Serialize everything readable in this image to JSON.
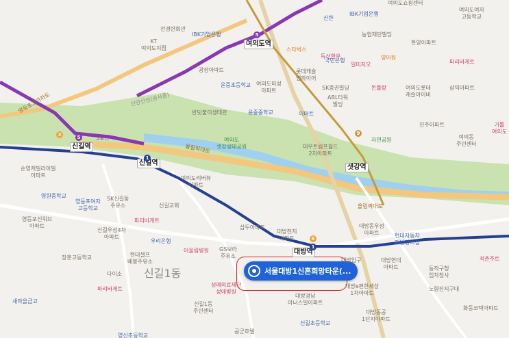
{
  "map": {
    "district_labels": {
      "sinil": "신길1동"
    },
    "selected_place": {
      "name": "서울대방1신혼희망타운(..."
    },
    "stations": {
      "yeouido": "여의도역",
      "singil": "신길역",
      "singil_left": "신길역",
      "daebang": "대방역",
      "saetgang": "샛강역"
    },
    "line_badges": {
      "one": "1",
      "five": "5",
      "three": "3",
      "six": "6",
      "nine": "9",
      "five_label": "5호선"
    },
    "roads": {
      "olympic1": "올림픽대로",
      "olympic2": "올림픽대로",
      "yeongdeungpo": "영등포고가차도",
      "sinansan": "신안산선(공사중)"
    },
    "labels": {
      "jeongyeong": "전경련회관",
      "ibk1": "IBK기업은행",
      "kt": "KT\n여의도지점",
      "ibk2": "IBK기업은행",
      "yeouido_shopping": "여의도쇼핑센터",
      "yeouido_girls": "여의도여자\n고등학교",
      "sinhan": "신한",
      "nonghyup": "농협재단빌딩",
      "hanyang": "한양아파트",
      "starbucks": "스타벅스",
      "toksan": "독산한우",
      "kookmin": "국민은행",
      "ilmi": "일미지오",
      "yeongeun": "영어원",
      "gwangjang": "광장아파트",
      "yuneung_cho": "윤중초등학교",
      "yeouidomisung": "여의도미성\n아파트",
      "lottecastle": "롯데캐슬\n엠파이어",
      "sk": "SK증권빌딩",
      "abl": "ABL타워\n빌딩",
      "ebin": "이마트",
      "donspring": "돈플랑",
      "yeouido_lotte": "여의도롯데\n캐슬아이비",
      "samik": "삼익아파트",
      "paris": "파리바게트",
      "banpo": "반딧불이생태관",
      "yuneung_jung": "윤중중학교",
      "yeouido_park": "여의도\n샛강생태공원",
      "daewoo": "대우트럼프월드\n2차아파트",
      "jinju": "진주아파트",
      "jayeon": "자연공원",
      "yeouido_center": "여의동\n주민센터",
      "sungmin": "순영캐빌라이빌\n아파트",
      "yeongwon": "영원중학교",
      "yeongdeungpo_high": "영등포여자\n고등학교",
      "sk_singil": "SK신길동\n주유소",
      "yeouido_riverview": "여의도리버뷰\n아파트",
      "singil_church": "신길교회",
      "yeongdeungpo_sinwi": "영등포신위브\n아파트",
      "singil_woosung": "신길우성4차\n아파트",
      "paris2": "파리바게트",
      "samdu": "삼두아파트",
      "daebang_chunji": "대방천지\n아파트",
      "daebang_woosung": "대방동우성\n아파트",
      "hyundai_motors": "현대자동차\n제방정비점",
      "woori": "우리은행",
      "janghoon": "장훈고등학교",
      "hyundai_self": "현대셀프\n배봉주유소",
      "eosul": "어울림병원",
      "gs": "GS보라\n주유소",
      "dainso": "다이소",
      "sungmo": "성애의료재단\n성애병원",
      "paris3": "파리바게트",
      "daebang_ip": "대방입구",
      "daebang_hyundai": "대방현대\n아파트",
      "daebang_yeonse": "대방e편한세상\n1차아파트",
      "daebang_gyeongnam": "대방경남\n아너스빌아파트",
      "saemaeul": "새마을금고",
      "singil1_center": "신길1동\n주민센터",
      "daebang_seongwon": "대방동공\n1단지아파트",
      "noryangjin": "노량진지구대",
      "dongjak": "동작구청\n임차청사",
      "yeongshin": "영신초등학교",
      "singil_cho": "신길초등학교",
      "gonggun": "공군호텔",
      "hwadong": "화동코텍아파트",
      "jeongsu": "적촌주트",
      "gacheol": "가톨\n여의도"
    },
    "colors": {
      "line1": "#243f94",
      "line5": "#8a38b0",
      "line9": "#c59a3c",
      "park": "#c9e2b0",
      "river": "#9fd0ef",
      "highway": "#f3c77e",
      "selection": "#e02020",
      "marker": "#1f62d9"
    }
  }
}
